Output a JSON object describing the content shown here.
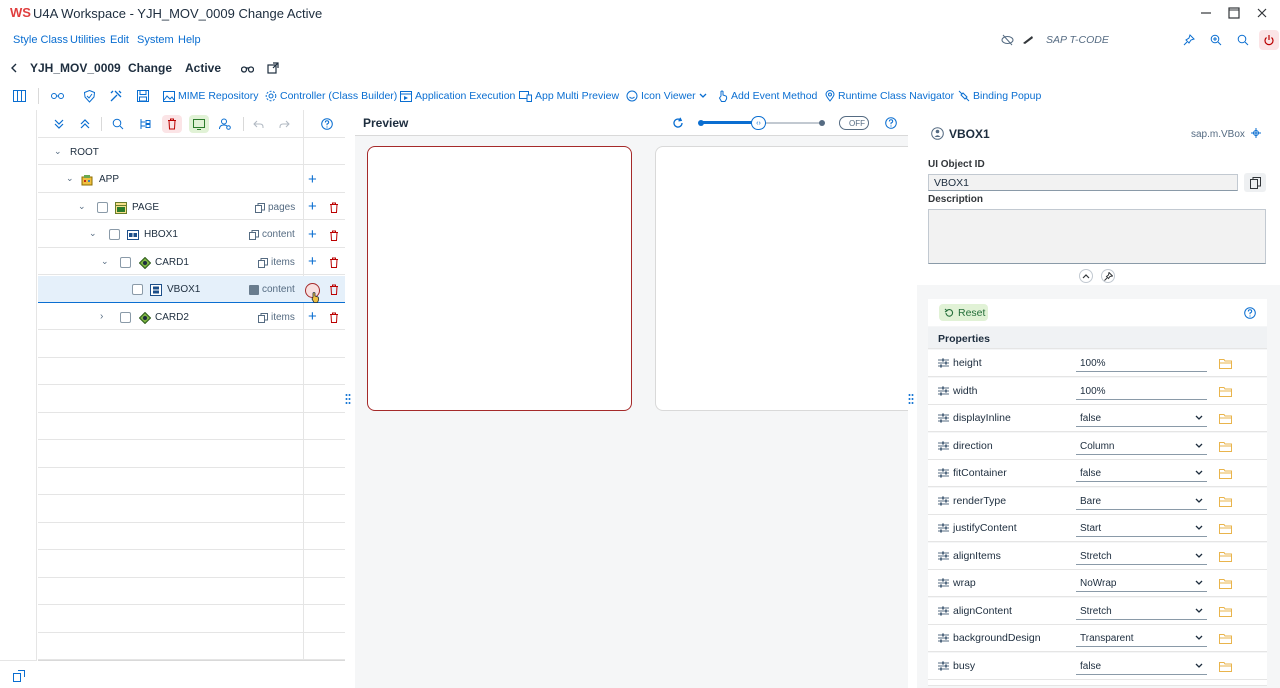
{
  "window": {
    "title": "U4A Workspace - YJH_MOV_0009 Change Active",
    "logo": "WS"
  },
  "menu": {
    "items": [
      "Style Class",
      "Utilities",
      "Edit",
      "System",
      "Help"
    ],
    "tcode_placeholder": "SAP T-CODE"
  },
  "header": {
    "app_id": "YJH_MOV_0009",
    "mode": "Change",
    "status": "Active"
  },
  "toolbar": {
    "buttons": [
      "MIME Repository",
      "Controller (Class Builder)",
      "Application Execution",
      "App Multi Preview",
      "Icon Viewer",
      "Add Event Method",
      "Runtime Class Navigator",
      "Binding Popup"
    ]
  },
  "tree": {
    "nodes": [
      {
        "name": "ROOT",
        "aggregation": ""
      },
      {
        "name": "APP",
        "aggregation": ""
      },
      {
        "name": "PAGE",
        "aggregation": "pages"
      },
      {
        "name": "HBOX1",
        "aggregation": "content"
      },
      {
        "name": "CARD1",
        "aggregation": "items"
      },
      {
        "name": "VBOX1",
        "aggregation": "content"
      },
      {
        "name": "CARD2",
        "aggregation": "items"
      }
    ]
  },
  "preview": {
    "title": "Preview",
    "toggle": "OFF"
  },
  "details": {
    "object_name": "VBOX1",
    "object_class": "sap.m.VBox",
    "ui_object_id_label": "UI Object ID",
    "ui_object_id": "VBOX1",
    "description_label": "Description",
    "reset_label": "Reset",
    "properties_label": "Properties",
    "properties": [
      {
        "name": "height",
        "value": "100%"
      },
      {
        "name": "width",
        "value": "100%"
      },
      {
        "name": "displayInline",
        "value": "false"
      },
      {
        "name": "direction",
        "value": "Column"
      },
      {
        "name": "fitContainer",
        "value": "false"
      },
      {
        "name": "renderType",
        "value": "Bare"
      },
      {
        "name": "justifyContent",
        "value": "Start"
      },
      {
        "name": "alignItems",
        "value": "Stretch"
      },
      {
        "name": "wrap",
        "value": "NoWrap"
      },
      {
        "name": "alignContent",
        "value": "Stretch"
      },
      {
        "name": "backgroundDesign",
        "value": "Transparent"
      },
      {
        "name": "busy",
        "value": "false"
      }
    ]
  },
  "colors": {
    "accent": "#0a6ed1",
    "danger": "#bb0000",
    "selected_row": "#e5f0fa"
  }
}
